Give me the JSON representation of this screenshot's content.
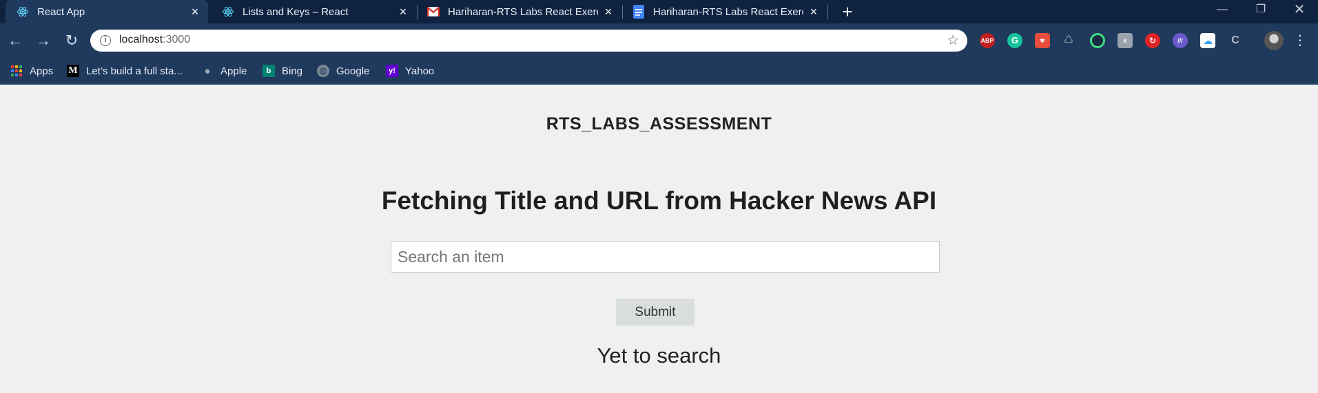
{
  "tabs": [
    {
      "title": "React App",
      "icon": "react-icon",
      "active": true
    },
    {
      "title": "Lists and Keys – React",
      "icon": "react-icon",
      "active": false
    },
    {
      "title": "Hariharan-RTS Labs React Exercis",
      "icon": "gmail-icon",
      "active": false
    },
    {
      "title": "Hariharan-RTS Labs React Exercis",
      "icon": "google-docs-icon",
      "active": false
    }
  ],
  "address": {
    "host": "localhost",
    "port": ":3000"
  },
  "extensions": [
    "adblock-plus-icon",
    "grammarly-icon",
    "extension-icon",
    "extension-icon",
    "extension-icon",
    "extension-icon",
    "extension-icon",
    "extension-icon",
    "cloud-icon",
    "extension-icon"
  ],
  "extension_labels": {
    "adblock": "ABP"
  },
  "bookmarks": [
    {
      "label": "Apps",
      "icon": "apps-grid-icon"
    },
    {
      "label": "Let’s build a full sta...",
      "icon": "medium-icon"
    },
    {
      "label": "Apple",
      "icon": "apple-icon"
    },
    {
      "label": "Bing",
      "icon": "bing-icon"
    },
    {
      "label": "Google",
      "icon": "globe-icon"
    },
    {
      "label": "Yahoo",
      "icon": "yahoo-icon"
    }
  ],
  "page": {
    "brand": "RTS_LABS_ASSESSMENT",
    "heading": "Fetching Title and URL from Hacker News API",
    "search_placeholder": "Search an item",
    "search_value": "",
    "submit_label": "Submit",
    "status_text": "Yet to search"
  },
  "colors": {
    "tabstrip": "#0f2240",
    "toolbar": "#203a5e",
    "page_background": "#f0f0f0",
    "button_background": "#d9dddd"
  }
}
